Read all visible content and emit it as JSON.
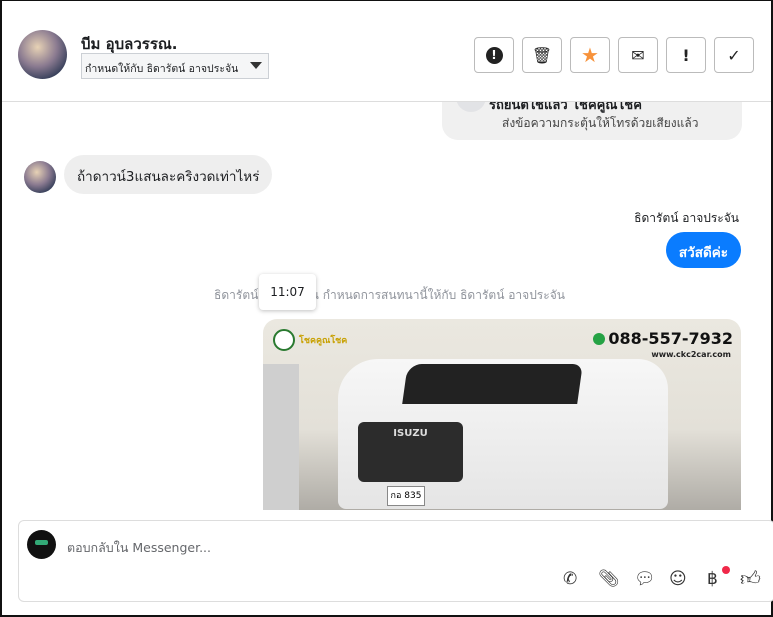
{
  "header": {
    "contact_name": "บีม อุบลวรรณ.",
    "assigned_to": "กำหนดให้กับ ธิดารัตน์ อาจประจัน",
    "toolbar": [
      {
        "name": "spam",
        "icon": "!"
      },
      {
        "name": "delete",
        "icon": "🗑"
      },
      {
        "name": "star",
        "icon": "★"
      },
      {
        "name": "mark-unread",
        "icon": "✉"
      },
      {
        "name": "follow-up",
        "icon": "!"
      },
      {
        "name": "done",
        "icon": "✓"
      }
    ]
  },
  "messages": {
    "card_title": "รถยนต์ใช้แล้ว โชคคูณโชค",
    "card_subtitle": "ส่งข้อความกระตุ้นให้โทรด้วยเสียงแล้ว",
    "incoming": "ถ้าดาวน์3แสนละคริงวดเท่าไหร่",
    "sender_name": "ธิดารัตน์ อาจประจัน",
    "outgoing": "สวัสดีค่ะ",
    "system_note": "ธิดารัตน์ อาจประจัน กำหนดการสนทนานี้ให้กับ ธิดารัตน์ อาจประจัน",
    "tooltip_time": "11:07",
    "image": {
      "phone": "088-557-7932",
      "website": "www.ckc2car.com",
      "brand": "ISUZU",
      "plate": "กอ 835",
      "dealer": "โชคคูณโชค"
    }
  },
  "composer": {
    "placeholder": "ตอบกลับใน Messenger...",
    "icons": [
      "call-add-icon",
      "attach-icon",
      "saved-reply-icon",
      "emoji-icon",
      "payment-icon",
      "like-icon"
    ],
    "badge_color": "#f02849"
  },
  "colors": {
    "accent": "#0a7cff",
    "star": "#f7923b"
  }
}
